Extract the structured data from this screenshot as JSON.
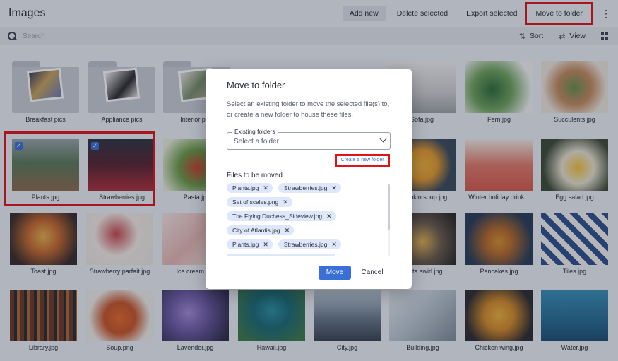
{
  "header": {
    "title": "Images",
    "actions": {
      "add_new": "Add new",
      "delete_selected": "Delete selected",
      "export_selected": "Export selected",
      "move_to_folder": "Move to folder"
    },
    "more_icon": "kebab-menu-icon"
  },
  "search": {
    "placeholder": "Search",
    "sort_label": "Sort",
    "view_label": "View"
  },
  "folders": [
    {
      "name": "Breakfast pics"
    },
    {
      "name": "Appliance pics"
    },
    {
      "name": "Interior pics"
    }
  ],
  "images": [
    {
      "name": "Sofa.jpg"
    },
    {
      "name": "Fern.jpg"
    },
    {
      "name": "Succulents.jpg"
    },
    {
      "name": "Plants.jpg",
      "selected": true
    },
    {
      "name": "Strawberries.jpg",
      "selected": true
    },
    {
      "name": "Pasta.jpg"
    },
    {
      "name": "Pumpkin soup.jpg"
    },
    {
      "name": "Winter holiday drink..."
    },
    {
      "name": "Egg salad.jpg"
    },
    {
      "name": "Toast.jpg"
    },
    {
      "name": "Strawberry parfait.jpg"
    },
    {
      "name": "Ice cream.jpg"
    },
    {
      "name": "Pasta swirl.jpg"
    },
    {
      "name": "Pancakes.jpg"
    },
    {
      "name": "Tiles.jpg"
    },
    {
      "name": "Library.jpg"
    },
    {
      "name": "Soup.png"
    },
    {
      "name": "Lavender.jpg"
    },
    {
      "name": "Hawaii.jpg"
    },
    {
      "name": "City.jpg"
    },
    {
      "name": "Building.jpg"
    },
    {
      "name": "Chicken wing.jpg"
    },
    {
      "name": "Water.jpg"
    }
  ],
  "modal": {
    "title": "Move to folder",
    "description": "Select an existing folder to move the selected file(s) to, or create a new folder to house these files.",
    "folder_field_label": "Existing folders",
    "folder_field_placeholder": "Select a folder",
    "create_link": "Create a new folder",
    "files_label": "Files to be moved",
    "files": [
      [
        "Plants.jpg",
        "Strawberries.jpg"
      ],
      [
        "Set of scales.png"
      ],
      [
        "The Flying Duchess_Sideview.jpg"
      ],
      [
        "City of Atlantis.jpg"
      ],
      [
        "Plants.jpg",
        "Strawberries.jpg"
      ]
    ],
    "move_label": "Move",
    "cancel_label": "Cancel"
  },
  "colors": {
    "accent": "#3b6fd8",
    "highlight": "#e0131a",
    "chip": "#dfe8fb"
  }
}
